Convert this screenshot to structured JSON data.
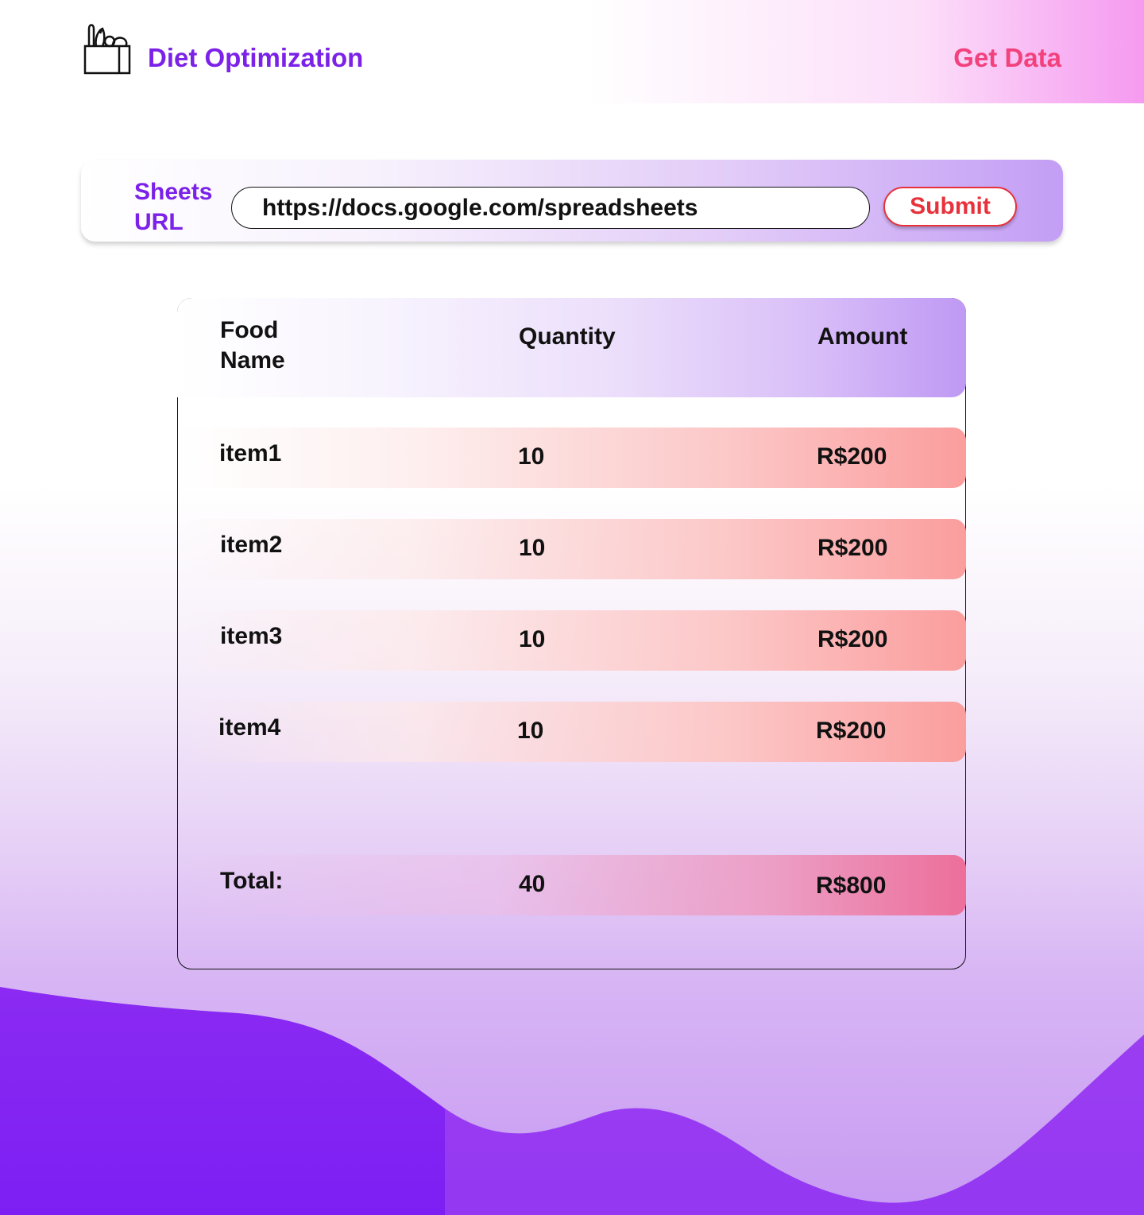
{
  "header": {
    "title": "Diet Optimization",
    "get_data_label": "Get Data",
    "logo_icon": "grocery-bag-icon"
  },
  "url_form": {
    "label_line1": "Sheets",
    "label_line2": "URL",
    "input_value": "https://docs.google.com/spreadsheets",
    "submit_label": "Submit"
  },
  "table": {
    "columns": {
      "food_name_line1": "Food",
      "food_name_line2": "Name",
      "quantity": "Quantity",
      "amount": "Amount"
    },
    "rows": [
      {
        "name": "item1",
        "quantity": "10",
        "amount": "R$200"
      },
      {
        "name": "item2",
        "quantity": "10",
        "amount": "R$200"
      },
      {
        "name": "item3",
        "quantity": "10",
        "amount": "R$200"
      },
      {
        "name": "item4",
        "quantity": "10",
        "amount": "R$200"
      }
    ],
    "total": {
      "label": "Total:",
      "quantity": "40",
      "amount": "R$800"
    }
  },
  "colors": {
    "brand_purple": "#7b21e8",
    "accent_pink": "#f2417c",
    "submit_red": "#e8323b"
  }
}
